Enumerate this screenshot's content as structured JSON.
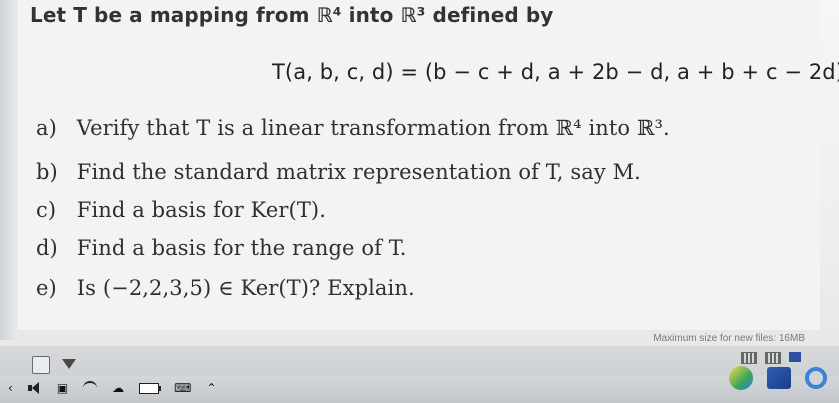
{
  "problem": {
    "intro": "Let T be a mapping from ℝ⁴ into ℝ³ defined by",
    "formula": "T(a, b, c, d) = (b − c + d, a + 2b − d, a + b + c − 2d)",
    "questions": [
      {
        "label": "a)",
        "text": "Verify that T is a linear transformation from ℝ⁴ into ℝ³."
      },
      {
        "label": "b)",
        "text": "Find the standard matrix representation of T, say M."
      },
      {
        "label": "c)",
        "text": "Find a basis for Ker(T)."
      },
      {
        "label": "d)",
        "text": "Find a basis for the range of T."
      },
      {
        "label": "e)",
        "text": "Is (−2,2,3,5) ∈ Ker(T)? Explain."
      }
    ]
  },
  "footer": {
    "max_size": "Maximum size for new files: 16MB"
  },
  "taskbar": {
    "left_icons": [
      "chevron-left-icon",
      "volume-icon",
      "tablet-icon",
      "wifi-icon",
      "cloud-icon",
      "battery-icon",
      "keyboard-icon",
      "chevron-up-icon"
    ],
    "right_icons": [
      "grid-icon",
      "list-icon",
      "chrome-icon",
      "mail-icon",
      "edge-icon"
    ]
  },
  "colors": {
    "background": "#f3f3f3",
    "taskbar": "#c7cacc",
    "text": "#2f2f2f"
  }
}
